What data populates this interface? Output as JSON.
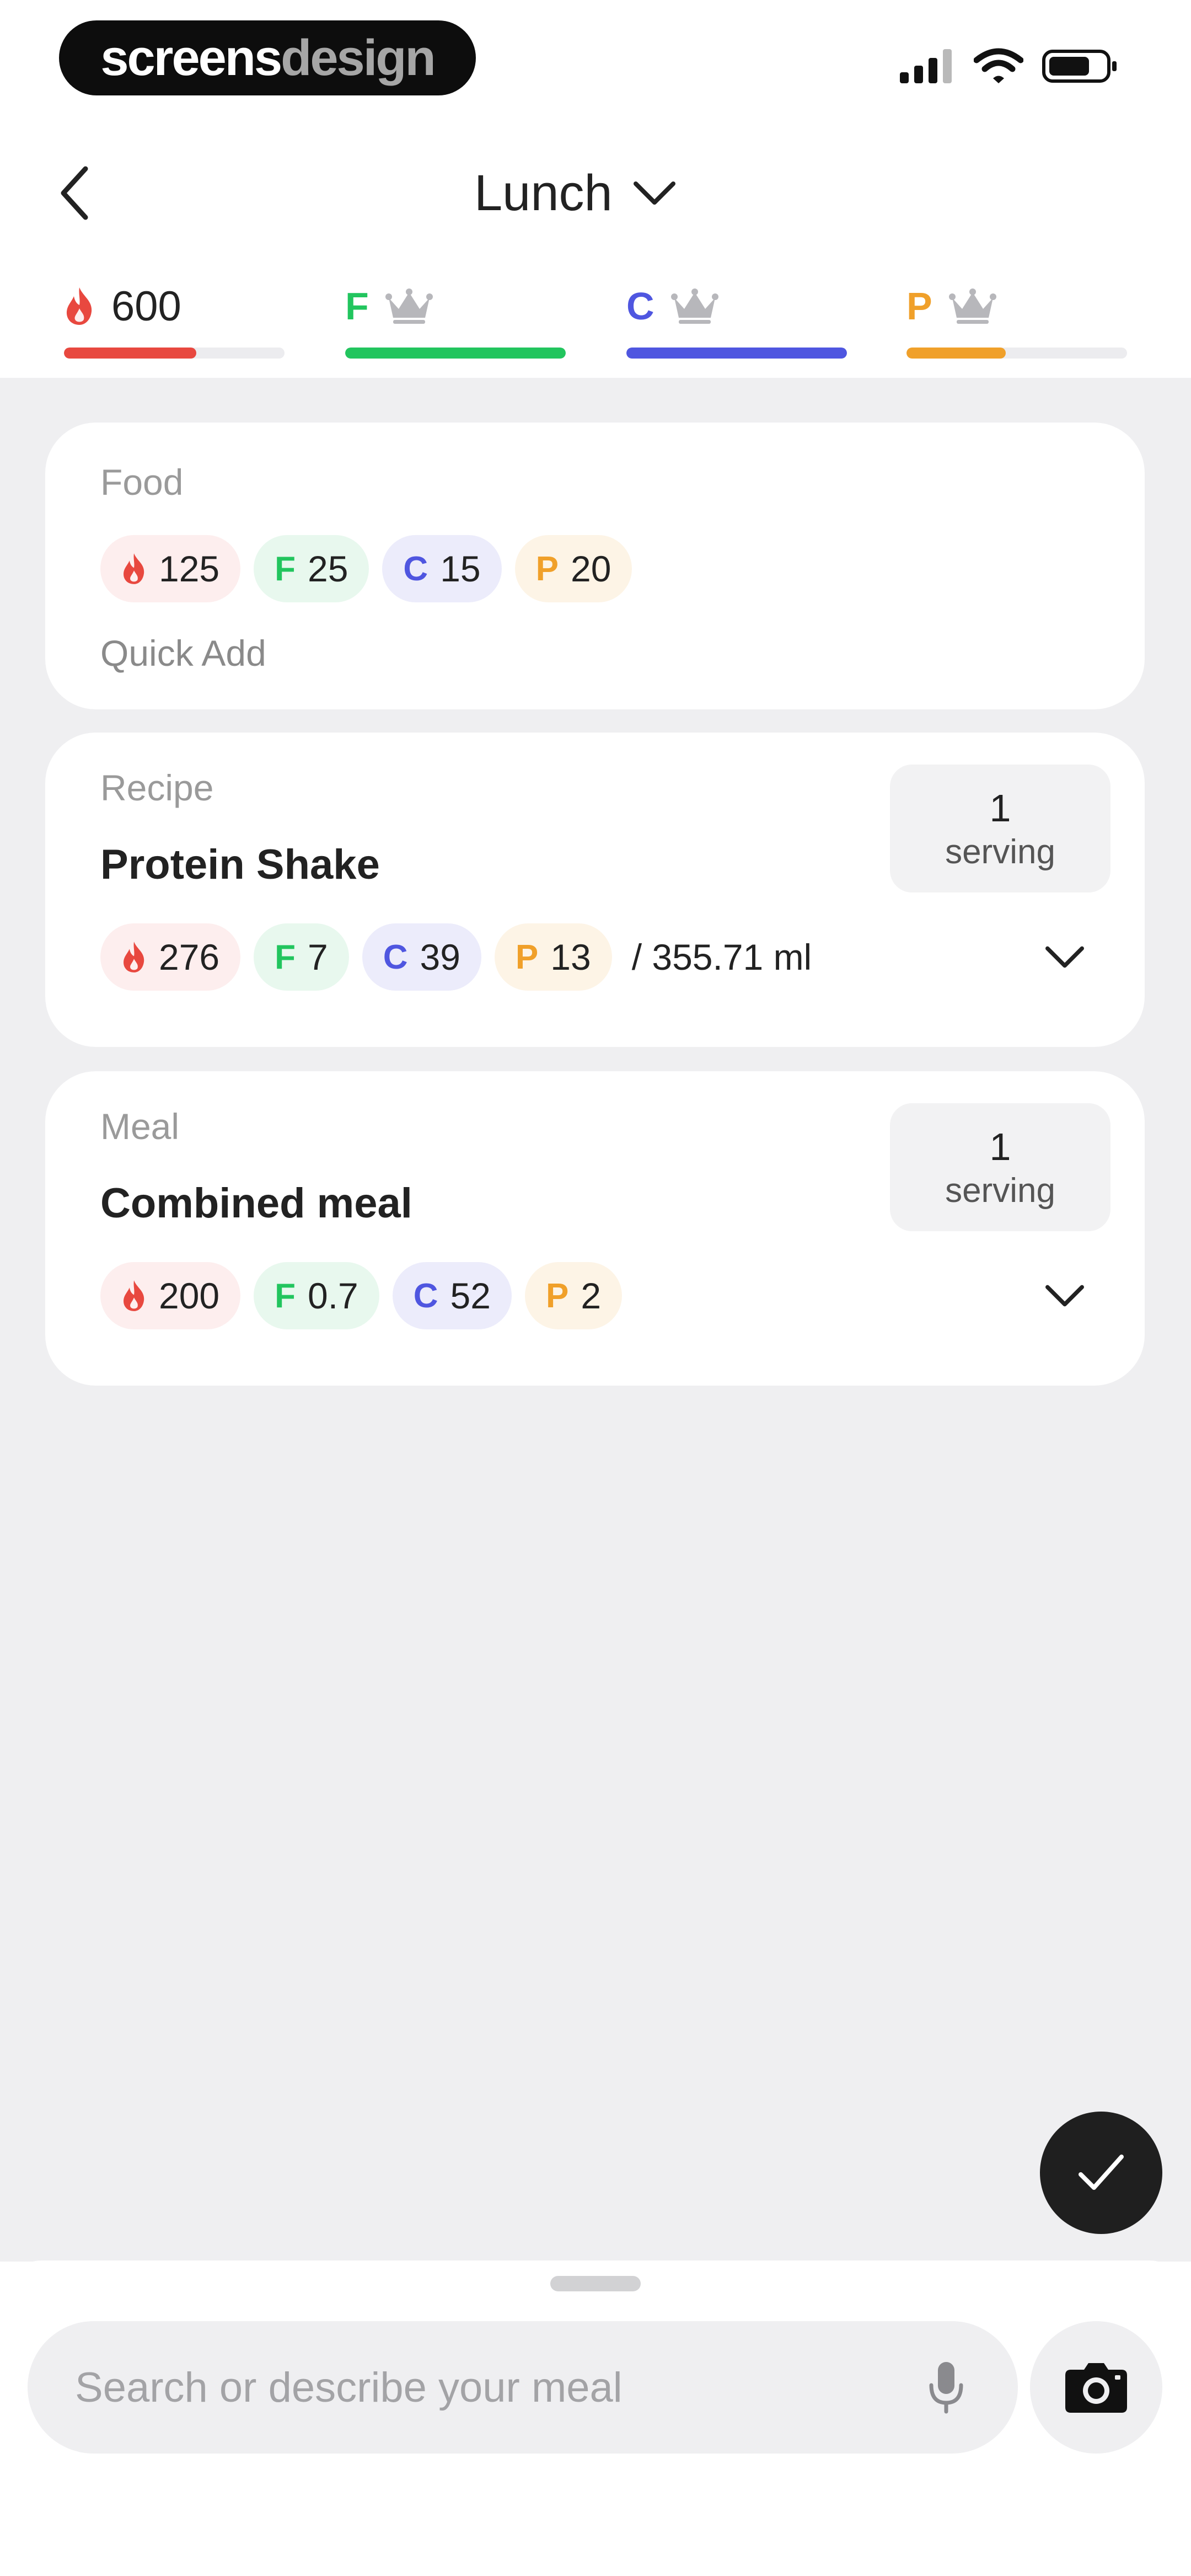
{
  "status_bar": {
    "brand_primary": "screens",
    "brand_secondary": "design",
    "icons": [
      "signal-icon",
      "wifi-icon",
      "battery-icon"
    ]
  },
  "header": {
    "back_icon": "chevron-left-icon",
    "title": "Lunch",
    "dropdown_icon": "chevron-down-icon"
  },
  "macro_tabs": [
    {
      "key": "calories",
      "label": "600",
      "icon": "flame-icon",
      "color": "#e8483f",
      "progress": 0.6
    },
    {
      "key": "fat",
      "letter": "F",
      "icon": "crown-icon",
      "color": "#22c55e",
      "progress": 1.0
    },
    {
      "key": "carbs",
      "letter": "C",
      "icon": "crown-icon",
      "color": "#4f56e0",
      "progress": 1.0
    },
    {
      "key": "protein",
      "letter": "P",
      "icon": "crown-icon",
      "color": "#f0a02a",
      "progress": 0.45
    }
  ],
  "items": [
    {
      "type_label": "Food",
      "calories": "125",
      "fat": {
        "letter": "F",
        "value": "25"
      },
      "carbs": {
        "letter": "C",
        "value": "15"
      },
      "protein": {
        "letter": "P",
        "value": "20"
      },
      "action": "Quick Add"
    },
    {
      "type_label": "Recipe",
      "name": "Protein Shake",
      "serving_qty": "1",
      "serving_unit": "serving",
      "calories": "276",
      "fat": {
        "letter": "F",
        "value": "7"
      },
      "carbs": {
        "letter": "C",
        "value": "39"
      },
      "protein": {
        "letter": "P",
        "value": "13"
      },
      "per_amount": "/ 355.71 ml"
    },
    {
      "type_label": "Meal",
      "name": "Combined meal",
      "serving_qty": "1",
      "serving_unit": "serving",
      "calories": "200",
      "fat": {
        "letter": "F",
        "value": "0.7"
      },
      "carbs": {
        "letter": "C",
        "value": "52"
      },
      "protein": {
        "letter": "P",
        "value": "2"
      }
    }
  ],
  "search": {
    "placeholder": "Search or describe your meal",
    "value": "",
    "mic_icon": "microphone-icon",
    "camera_icon": "camera-icon"
  },
  "confirm_icon": "checkmark-icon",
  "colors": {
    "calories": "#e8483f",
    "fat": "#22c55e",
    "carbs": "#4f56e0",
    "protein": "#f0a02a",
    "background": "#efeff1",
    "card": "#ffffff"
  }
}
